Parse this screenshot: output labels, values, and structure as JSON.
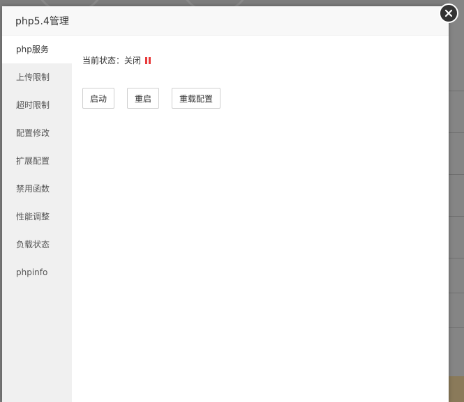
{
  "modal": {
    "title": "php5.4管理",
    "close_icon": "close-icon"
  },
  "sidebar": {
    "items": [
      {
        "label": "php服务",
        "active": true
      },
      {
        "label": "上传限制",
        "active": false
      },
      {
        "label": "超时限制",
        "active": false
      },
      {
        "label": "配置修改",
        "active": false
      },
      {
        "label": "扩展配置",
        "active": false
      },
      {
        "label": "禁用函数",
        "active": false
      },
      {
        "label": "性能调整",
        "active": false
      },
      {
        "label": "负载状态",
        "active": false
      },
      {
        "label": "phpinfo",
        "active": false
      }
    ]
  },
  "service": {
    "status_label": "当前状态：关闭",
    "status_icon": "paused-icon",
    "status_color": "#e8393a",
    "buttons": {
      "start": "启动",
      "restart": "重启",
      "reload": "重载配置"
    }
  }
}
